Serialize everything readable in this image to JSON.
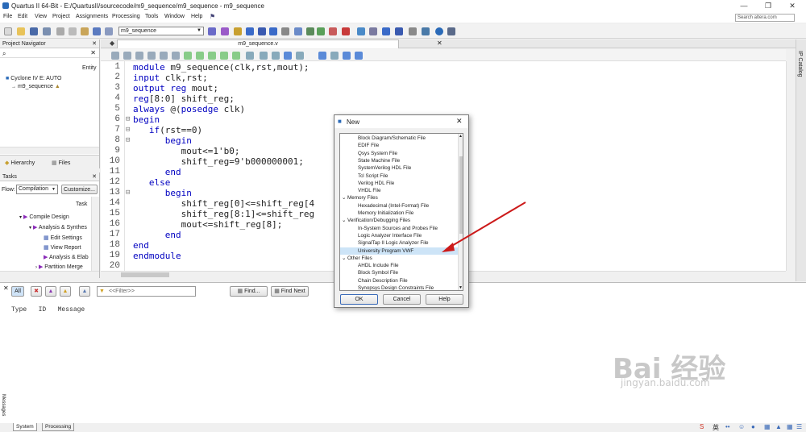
{
  "window": {
    "title": "Quartus II 64-Bit - E:/QuartusII/sourcecode/m9_sequence/m9_sequence - m9_sequence",
    "search_placeholder": "Search altera.com"
  },
  "menu": [
    "File",
    "Edit",
    "View",
    "Project",
    "Assignments",
    "Processing",
    "Tools",
    "Window",
    "Help"
  ],
  "toolbar": {
    "revision": "m9_sequence"
  },
  "navigator": {
    "title": "Project Navigator",
    "column": "Entity",
    "device": "Cyclone IV E: AUTO",
    "top_entity": "m9_sequence",
    "tabs": [
      "Hierarchy",
      "Files"
    ]
  },
  "tasks": {
    "title": "Tasks",
    "flow_label": "Flow:",
    "flow_value": "Compilation",
    "customize": "Customize...",
    "column": "Task",
    "items": [
      "Compile Design",
      "Analysis & Synthes",
      "Edit Settings",
      "View Report",
      "Analysis & Elab",
      "Partition Merge"
    ]
  },
  "editor": {
    "tab": "m9_sequence.v",
    "lines": [
      "module m9_sequence(clk,rst,mout);",
      "input clk,rst;",
      "output reg mout;",
      "reg[8:0] shift_reg;",
      "always @(posedge clk)",
      "begin",
      "   if(rst==0)",
      "      begin",
      "         mout<=1'b0;",
      "         shift_reg=9'b000000001;",
      "      end",
      "   else",
      "      begin",
      "         shift_reg[0]<=shift_reg[4",
      "         shift_reg[8:1]<=shift_reg",
      "         mout<=shift_reg[8];",
      "      end",
      "end",
      "endmodule",
      ""
    ],
    "line_numbers": [
      "1",
      "2",
      "3",
      "4",
      "5",
      "6",
      "7",
      "8",
      "9",
      "10",
      "11",
      "12",
      "13",
      "14",
      "15",
      "16",
      "17",
      "18",
      "19",
      "20"
    ]
  },
  "side_catalog": "IP Catalog",
  "messages": {
    "filter_buttons": [
      "All"
    ],
    "filter_placeholder": "<<Filter>>",
    "find": "Find...",
    "find_next": "Find Next",
    "headers": "Type   ID   Message",
    "side_label": "Messages",
    "tabs": [
      "System",
      "Processing"
    ]
  },
  "dialog": {
    "title": "New",
    "items": [
      {
        "text": "Block Diagram/Schematic File",
        "kind": "item"
      },
      {
        "text": "EDIF File",
        "kind": "item"
      },
      {
        "text": "Qsys System File",
        "kind": "item"
      },
      {
        "text": "State Machine File",
        "kind": "item"
      },
      {
        "text": "SystemVerilog HDL File",
        "kind": "item"
      },
      {
        "text": "Tcl Script File",
        "kind": "item"
      },
      {
        "text": "Verilog HDL File",
        "kind": "item"
      },
      {
        "text": "VHDL File",
        "kind": "item"
      },
      {
        "text": "Memory Files",
        "kind": "cat"
      },
      {
        "text": "Hexadecimal (Intel-Format) File",
        "kind": "item"
      },
      {
        "text": "Memory Initialization File",
        "kind": "item"
      },
      {
        "text": "Verification/Debugging Files",
        "kind": "cat"
      },
      {
        "text": "In-System Sources and Probes File",
        "kind": "item"
      },
      {
        "text": "Logic Analyzer Interface File",
        "kind": "item"
      },
      {
        "text": "SignalTap II Logic Analyzer File",
        "kind": "item"
      },
      {
        "text": "University Program VWF",
        "kind": "item",
        "selected": true
      },
      {
        "text": "Other Files",
        "kind": "cat"
      },
      {
        "text": "AHDL Include File",
        "kind": "item"
      },
      {
        "text": "Block Symbol File",
        "kind": "item"
      },
      {
        "text": "Chain Description File",
        "kind": "item"
      },
      {
        "text": "Synopsys Design Constraints File",
        "kind": "item"
      }
    ],
    "ok": "OK",
    "cancel": "Cancel",
    "help": "Help"
  },
  "watermark": {
    "brand": "Bai 经验",
    "url": "jingyan.baidu.com"
  },
  "colors": {
    "accent": "#cc1a1a",
    "selection": "#cde4f7",
    "keyword": "#0000c0"
  }
}
